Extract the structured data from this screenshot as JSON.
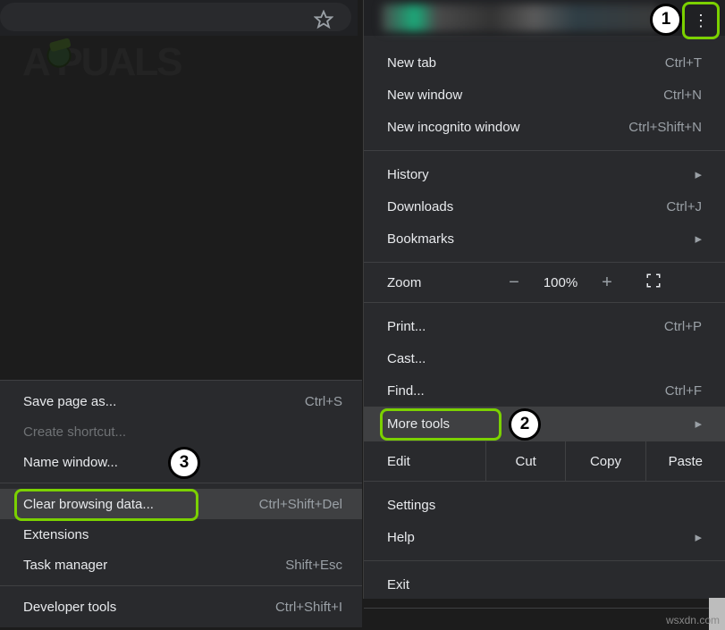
{
  "watermark_text": "A  PUALS",
  "kebab": {
    "badge": "1"
  },
  "main_menu": {
    "groups": [
      [
        {
          "label": "New tab",
          "shortcut": "Ctrl+T"
        },
        {
          "label": "New window",
          "shortcut": "Ctrl+N"
        },
        {
          "label": "New incognito window",
          "shortcut": "Ctrl+Shift+N"
        }
      ],
      [
        {
          "label": "History",
          "submenu": true
        },
        {
          "label": "Downloads",
          "shortcut": "Ctrl+J"
        },
        {
          "label": "Bookmarks",
          "submenu": true
        }
      ]
    ],
    "zoom": {
      "label": "Zoom",
      "minus": "−",
      "pct": "100%",
      "plus": "+",
      "full_icon": "⛶"
    },
    "groups2": [
      [
        {
          "label": "Print...",
          "shortcut": "Ctrl+P"
        },
        {
          "label": "Cast...",
          "shortcut": ""
        },
        {
          "label": "Find...",
          "shortcut": "Ctrl+F"
        },
        {
          "label": "More tools",
          "submenu": true,
          "highlight": true,
          "badge": "2"
        }
      ]
    ],
    "edit": {
      "label": "Edit",
      "cut": "Cut",
      "copy": "Copy",
      "paste": "Paste"
    },
    "groups3": [
      [
        {
          "label": "Settings",
          "shortcut": ""
        },
        {
          "label": "Help",
          "submenu": true
        }
      ],
      [
        {
          "label": "Exit",
          "shortcut": ""
        }
      ]
    ]
  },
  "sub_menu": {
    "groups": [
      [
        {
          "label": "Save page as...",
          "shortcut": "Ctrl+S"
        },
        {
          "label": "Create shortcut...",
          "shortcut": "",
          "disabled": true
        },
        {
          "label": "Name window...",
          "shortcut": "",
          "badge": "3"
        }
      ],
      [
        {
          "label": "Clear browsing data...",
          "shortcut": "Ctrl+Shift+Del",
          "selected": true,
          "green": true
        },
        {
          "label": "Extensions",
          "shortcut": ""
        },
        {
          "label": "Task manager",
          "shortcut": "Shift+Esc"
        }
      ],
      [
        {
          "label": "Developer tools",
          "shortcut": "Ctrl+Shift+I"
        }
      ]
    ]
  },
  "credit": "wsxdn.com"
}
